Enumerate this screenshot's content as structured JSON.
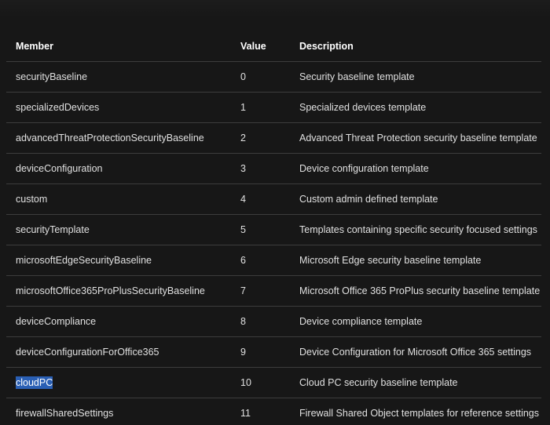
{
  "table": {
    "headers": [
      "Member",
      "Value",
      "Description"
    ],
    "rows": [
      {
        "member": "securityBaseline",
        "value": "0",
        "description": "Security baseline template"
      },
      {
        "member": "specializedDevices",
        "value": "1",
        "description": "Specialized devices template"
      },
      {
        "member": "advancedThreatProtectionSecurityBaseline",
        "value": "2",
        "description": "Advanced Threat Protection security baseline template"
      },
      {
        "member": "deviceConfiguration",
        "value": "3",
        "description": "Device configuration template"
      },
      {
        "member": "custom",
        "value": "4",
        "description": "Custom admin defined template"
      },
      {
        "member": "securityTemplate",
        "value": "5",
        "description": "Templates containing specific security focused settings"
      },
      {
        "member": "microsoftEdgeSecurityBaseline",
        "value": "6",
        "description": "Microsoft Edge security baseline template"
      },
      {
        "member": "microsoftOffice365ProPlusSecurityBaseline",
        "value": "7",
        "description": "Microsoft Office 365 ProPlus security baseline template"
      },
      {
        "member": "deviceCompliance",
        "value": "8",
        "description": "Device compliance template"
      },
      {
        "member": "deviceConfigurationForOffice365",
        "value": "9",
        "description": "Device Configuration for Microsoft Office 365 settings"
      },
      {
        "member": "cloudPC",
        "value": "10",
        "description": "Cloud PC security baseline template",
        "selected": true
      },
      {
        "member": "firewallSharedSettings",
        "value": "11",
        "description": "Firewall Shared Object templates for reference settings"
      }
    ]
  },
  "colors": {
    "background": "#171717",
    "row_divider": "#3d3d3d",
    "selection": "#2a5fb4"
  }
}
